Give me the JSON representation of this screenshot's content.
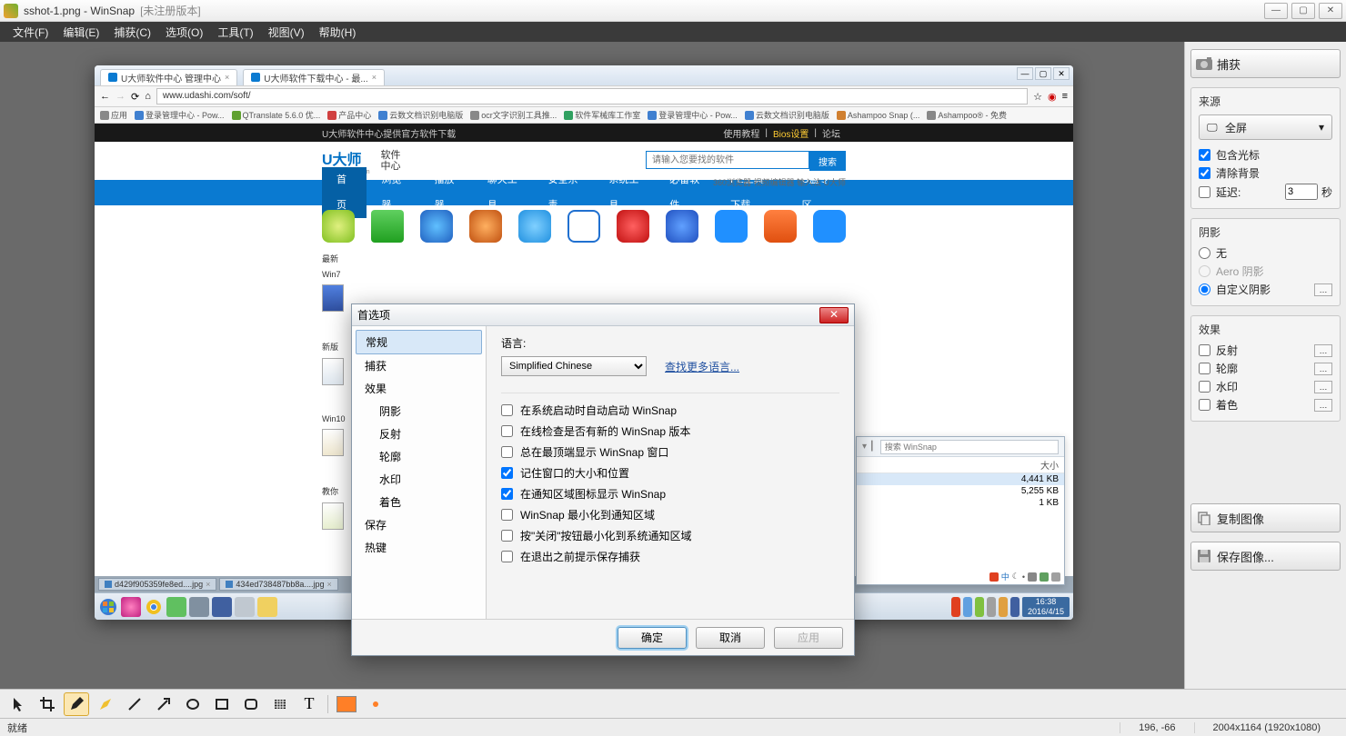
{
  "titlebar": {
    "filename": "sshot-1.png",
    "appname": "WinSnap",
    "suffix": "[未注册版本]"
  },
  "menu": {
    "file": "文件(F)",
    "edit": "编辑(E)",
    "capture": "捕获(C)",
    "options": "选项(O)",
    "tools": "工具(T)",
    "view": "视图(V)",
    "help": "帮助(H)"
  },
  "rightpanel": {
    "capture_btn": "捕获",
    "source": {
      "title": "来源",
      "mode": "全屏",
      "include_cursor": "包含光标",
      "clear_bg": "清除背景",
      "delay_label": "延迟:",
      "delay_value": "3",
      "delay_unit": "秒"
    },
    "shadow": {
      "title": "阴影",
      "none": "无",
      "aero": "Aero 阴影",
      "custom": "自定义阴影"
    },
    "effects": {
      "title": "效果",
      "reflect": "反射",
      "outline": "轮廓",
      "watermark": "水印",
      "color": "着色"
    },
    "copy_btn": "复制图像",
    "save_btn": "保存图像..."
  },
  "statusbar": {
    "ready": "就绪",
    "coords": "196, -66",
    "dims": "2004x1164 (1920x1080)"
  },
  "pref": {
    "title": "首选项",
    "nav": {
      "general": "常规",
      "capture": "捕获",
      "effects": "效果",
      "shadow": "阴影",
      "reflect": "反射",
      "outline": "轮廓",
      "watermark": "水印",
      "color": "着色",
      "save": "保存",
      "hotkey": "热键"
    },
    "lang_label": "语言:",
    "lang_value": "Simplified Chinese",
    "more_lang": "查找更多语言...",
    "chk1": "在系统启动时自动启动 WinSnap",
    "chk2": "在线检查是否有新的 WinSnap 版本",
    "chk3": "总在最顶端显示 WinSnap 窗口",
    "chk4": "记住窗口的大小和位置",
    "chk5": "在通知区域图标显示 WinSnap",
    "chk6": "WinSnap 最小化到通知区域",
    "chk7": "按\"关闭\"按钮最小化到系统通知区域",
    "chk8": "在退出之前提示保存捕获",
    "ok": "确定",
    "cancel": "取消",
    "apply": "应用"
  },
  "browser": {
    "tab1": "U大师软件中心 管理中心",
    "tab2": "U大师软件下载中心 - 最...",
    "url": "www.udashi.com/soft/",
    "bookmarks": [
      "应用",
      "登录管理中心 - Pow...",
      "QTranslate 5.6.0 优...",
      "产品中心",
      "云数文档识别电脑版",
      "ocr文字识别工具推...",
      "软件军械库工作室",
      "登录管理中心 - Pow...",
      "云数文档识别电脑版",
      "Ashampoo Snap (...",
      "Ashampoo® - 免费"
    ]
  },
  "webpage": {
    "notice": "U大师软件中心提供官方软件下载",
    "links": {
      "tutorial": "使用教程",
      "bios": "Bios设置",
      "forum": "论坛"
    },
    "logo": "U大师",
    "logo_sub": "www.udashi.com",
    "subtitle": "软件\n中心",
    "search_placeholder": "请输入您要找的软件",
    "search_btn": "搜索",
    "search_hint": "360浏览器 视频编辑器 输入法 U大师",
    "nav": [
      "首页",
      "浏览器",
      "播放器",
      "聊天工具",
      "安全杀毒",
      "系统工具",
      "必备软件",
      "PE工具下载",
      "U盘专区"
    ],
    "left_labels": [
      "最新",
      "Win7",
      "新版",
      "Win10",
      "教你"
    ]
  },
  "explorer": {
    "search_placeholder": "搜索 WinSnap",
    "col_size": "大小",
    "rows": [
      "4,441 KB",
      "5,255 KB",
      "1 KB"
    ]
  },
  "tabs": {
    "t1": "d429f905359fe8ed....jpg",
    "t2": "434ed738487bb8a....jpg"
  },
  "taskbar": {
    "time": "16:38",
    "date": "2016/4/15"
  }
}
